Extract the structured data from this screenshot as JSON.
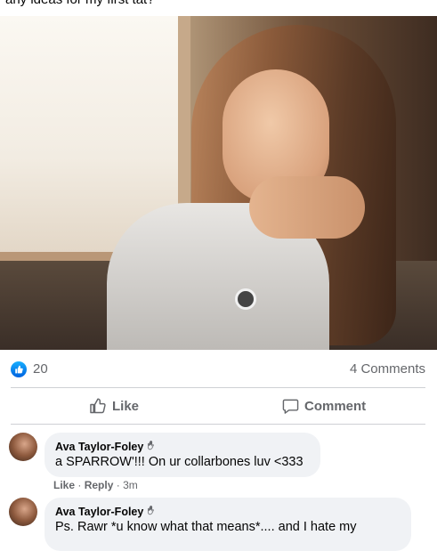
{
  "post": {
    "caption": "any ideas for my first tat?"
  },
  "reactions": {
    "icon": "like-icon",
    "count": "20",
    "comments_count": "4 Comments"
  },
  "actions": {
    "like_label": "Like",
    "comment_label": "Comment"
  },
  "comments": [
    {
      "author": "Ava Taylor-Foley",
      "badge_icon": "waving-hand-icon",
      "text": "a SPARROW'!!! On ur collarbones luv <333",
      "like_label": "Like",
      "separator": "·",
      "reply_label": "Reply",
      "time": "3m"
    },
    {
      "author": "Ava Taylor-Foley",
      "badge_icon": "waving-hand-icon",
      "text": "Ps. Rawr *u know what that means*.... and I hate my"
    }
  ],
  "colors": {
    "accent": "#1877f2",
    "secondary_text": "#65676b",
    "bubble_bg": "#f0f2f5",
    "divider": "#ced0d4"
  }
}
